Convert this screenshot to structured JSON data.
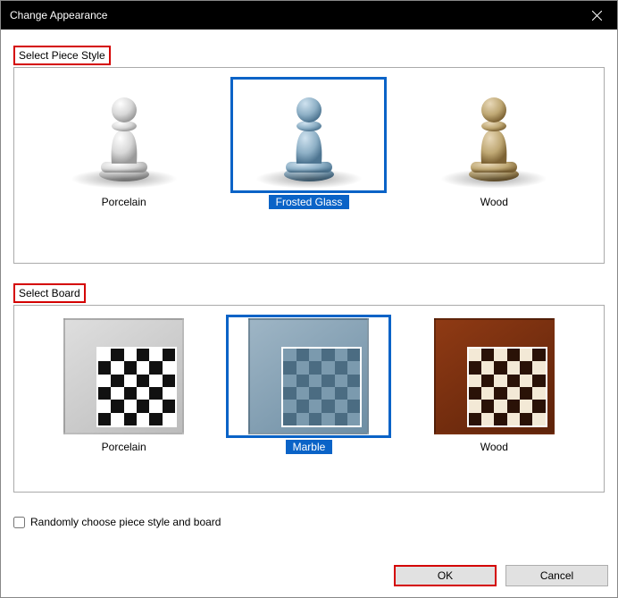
{
  "window": {
    "title": "Change Appearance"
  },
  "pieces": {
    "label": "Select Piece Style",
    "options": [
      {
        "name": "Porcelain",
        "selected": false
      },
      {
        "name": "Frosted Glass",
        "selected": true
      },
      {
        "name": "Wood",
        "selected": false
      }
    ]
  },
  "boards": {
    "label": "Select Board",
    "options": [
      {
        "name": "Porcelain",
        "selected": false
      },
      {
        "name": "Marble",
        "selected": true
      },
      {
        "name": "Wood",
        "selected": false
      }
    ]
  },
  "random_checkbox": {
    "label": "Randomly choose piece style and board",
    "checked": false
  },
  "buttons": {
    "ok": "OK",
    "cancel": "Cancel"
  },
  "highlights": {
    "pieces_label_boxed": true,
    "boards_label_boxed": true,
    "ok_boxed": true
  }
}
